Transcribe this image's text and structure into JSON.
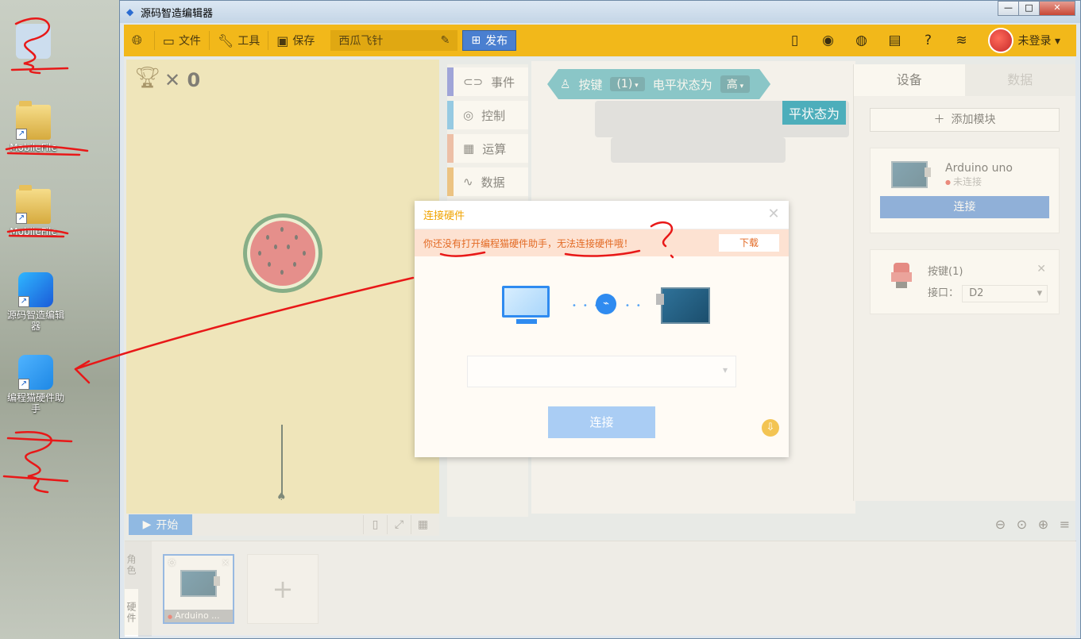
{
  "desktop": {
    "icons": [
      {
        "label": "MobileFile"
      },
      {
        "label": "MobileFile"
      },
      {
        "label": "源码智造编辑器"
      },
      {
        "label": "编程猫硬件助手"
      }
    ]
  },
  "window": {
    "title": "源码智造编辑器",
    "controls": {
      "minimize": "—",
      "maximize": "□",
      "close": "✕"
    }
  },
  "toolbar": {
    "file_label": "文件",
    "tools_label": "工具",
    "save_label": "保存",
    "project_name": "西瓜飞针",
    "publish_label": "发布",
    "login_label": "未登录"
  },
  "stage": {
    "score": "0",
    "start_label": "开始"
  },
  "categories": [
    {
      "label": "事件",
      "color": "#5c6bd6"
    },
    {
      "label": "控制",
      "color": "#4aaee8"
    },
    {
      "label": "运算",
      "color": "#e89a7a"
    },
    {
      "label": "数据",
      "color": "#e5a13a"
    }
  ],
  "workspace": {
    "block": {
      "label": "按键",
      "index": "(1)",
      "state_label": "电平状态为",
      "state_value": "高"
    },
    "hidden_text": "平状态为"
  },
  "right_panel": {
    "tabs": [
      {
        "label": "设备",
        "active": true
      },
      {
        "label": "数据",
        "active": false
      }
    ],
    "add_module_label": "添加模块",
    "board": {
      "name": "Arduino uno",
      "status": "未连接",
      "connect_label": "连接"
    },
    "module": {
      "name": "按键(1)",
      "port_label": "接口：",
      "port_value": "D2"
    }
  },
  "sprites": {
    "tab_role": "角色",
    "tab_hardware": "硬件",
    "card_label": "Arduino ..."
  },
  "modal": {
    "title": "连接硬件",
    "warning": "你还没有打开编程猫硬件助手，无法连接硬件哦！",
    "download_label": "下载",
    "connect_label": "连接"
  }
}
